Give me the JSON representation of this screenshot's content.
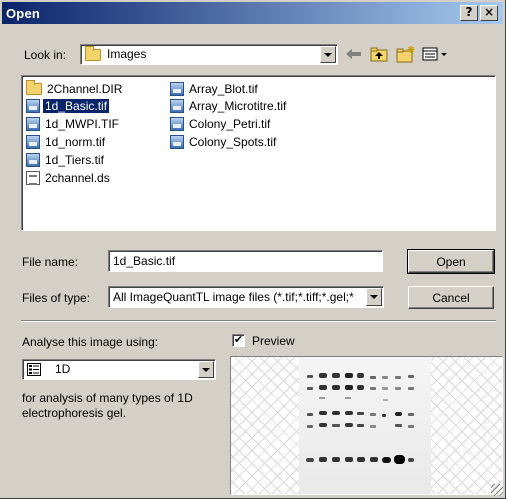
{
  "window": {
    "title": "Open",
    "help_label": "?",
    "close_label": "×"
  },
  "look_in": {
    "label": "Look in:",
    "value": "Images"
  },
  "files": [
    {
      "name": "2Channel.DIR",
      "type": "folder",
      "selected": false
    },
    {
      "name": "1d_Basic.tif",
      "type": "image",
      "selected": true
    },
    {
      "name": "1d_MWPI.TIF",
      "type": "image",
      "selected": false
    },
    {
      "name": "1d_norm.tif",
      "type": "image",
      "selected": false
    },
    {
      "name": "1d_Tiers.tif",
      "type": "image",
      "selected": false
    },
    {
      "name": "2channel.ds",
      "type": "dataset",
      "selected": false
    },
    {
      "name": "Array_Blot.tif",
      "type": "image",
      "selected": false
    },
    {
      "name": "Array_Microtitre.tif",
      "type": "image",
      "selected": false
    },
    {
      "name": "Colony_Petri.tif",
      "type": "image",
      "selected": false
    },
    {
      "name": "Colony_Spots.tif",
      "type": "image",
      "selected": false
    }
  ],
  "file_name": {
    "label": "File name:",
    "value": "1d_Basic.tif"
  },
  "file_type": {
    "label": "Files of type:",
    "value": "All ImageQuantTL image files (*.tif;*.tiff;*.gel;*"
  },
  "buttons": {
    "open": "Open",
    "cancel": "Cancel"
  },
  "analyse": {
    "label": "Analyse this image using:",
    "value": "1D",
    "description": "for analysis of many types of 1D electrophoresis gel."
  },
  "preview": {
    "label": "Preview",
    "checked": true,
    "check_mark": "✔"
  },
  "icons": {
    "back": "back-arrow-icon",
    "up": "up-folder-icon",
    "new_folder": "new-folder-icon",
    "view": "view-menu-icon"
  },
  "colors": {
    "title_start": "#0a246a",
    "title_end": "#a6caf0",
    "selection": "#0a246a"
  }
}
